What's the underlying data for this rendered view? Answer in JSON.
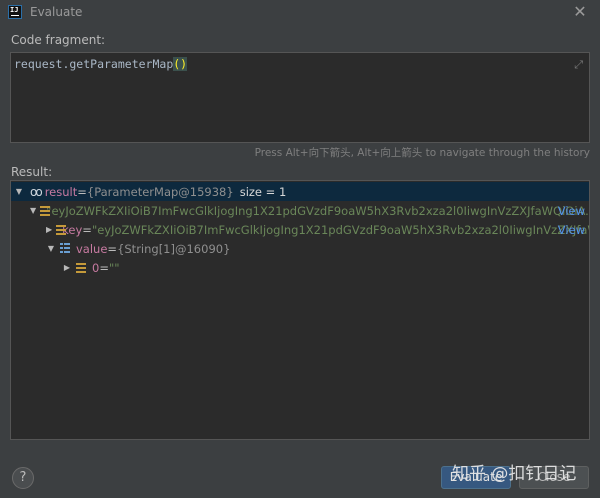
{
  "window": {
    "title": "Evaluate",
    "app_icon_text": "IJ"
  },
  "code": {
    "label": "Code fragment:",
    "text_before": "request.getParameterMap",
    "text_parens": "()"
  },
  "hint": "Press Alt+向下箭头, Alt+向上箭头 to navigate through the history",
  "result": {
    "label": "Result:",
    "root": {
      "name": "result",
      "eq": " = ",
      "type": "{ParameterMap@15938}",
      "size": "size = 1"
    },
    "entry": {
      "value": "\"eyJoZWFkZXIiOiB7ImFwcGlkIjogIng1X21pdGVzdF9oaW5hX3Rvb2xza2l0IiwgInVzZXJfaWQiOiA...",
      "view": "View"
    },
    "key": {
      "name": "key",
      "eq": " = ",
      "value": "\"eyJoZWFkZXIiOiB7ImFwcGlkIjogIng1X21pdGVzdF9oaW5hX3Rvb2xza2l0IiwgInVzZXJfaWQiOiA...",
      "view": "View"
    },
    "value": {
      "name": "value",
      "eq": " = ",
      "type": "{String[1]@16090}"
    },
    "item0": {
      "name": "0",
      "eq": " = ",
      "value": "\"\""
    }
  },
  "buttons": {
    "help": "?",
    "evaluate": "Evaluate",
    "close": "Close"
  },
  "watermark": "知乎 @扣钉日记",
  "colors": {
    "background": "#3c3f41",
    "editor": "#2b2b2b",
    "selection": "#0d293e",
    "link": "#5394ec",
    "string": "#6a8759"
  }
}
